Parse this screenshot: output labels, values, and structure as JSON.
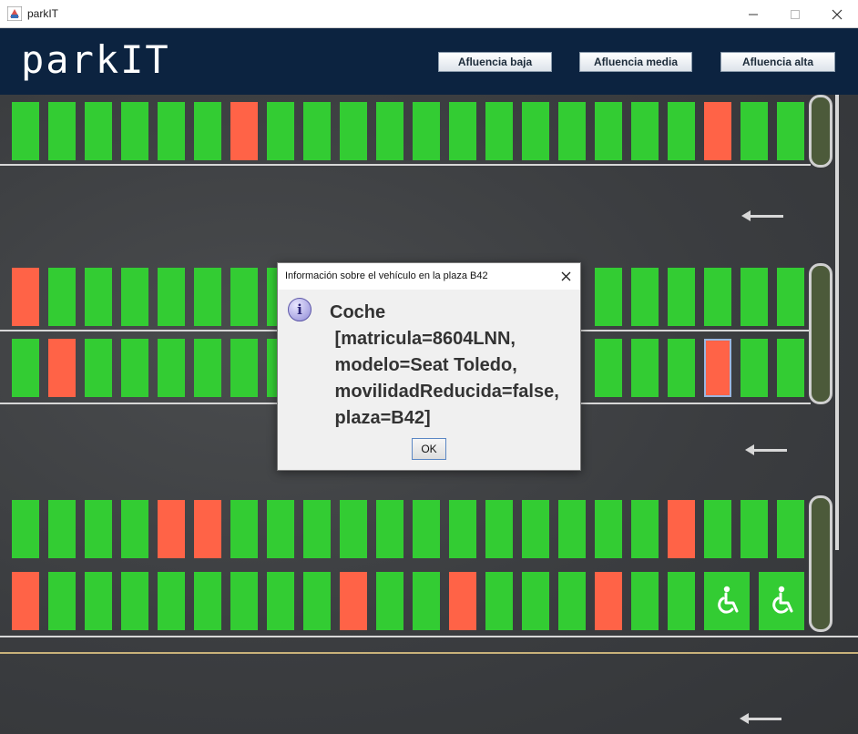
{
  "window": {
    "title": "parkIT",
    "minimize_icon": "minimize-icon",
    "maximize_icon": "maximize-icon",
    "close_icon": "close-icon"
  },
  "header": {
    "logo": "parkIT",
    "buttons": [
      {
        "label": "Afluencia baja"
      },
      {
        "label": "Afluencia media"
      },
      {
        "label": "Afluencia alta"
      }
    ]
  },
  "colors": {
    "free": "#33cc33",
    "occupied": "#ff6347",
    "header": "#0c2340"
  },
  "lot": {
    "row1": [
      "free",
      "free",
      "free",
      "free",
      "free",
      "free",
      "occupied",
      "free",
      "free",
      "free",
      "free",
      "free",
      "free",
      "free",
      "free",
      "free",
      "free",
      "free",
      "free",
      "occupied",
      "free",
      "free"
    ],
    "row2": [
      "occupied",
      "free",
      "free",
      "free",
      "free",
      "free",
      "free",
      "free",
      "hidden",
      "hidden",
      "hidden",
      "hidden",
      "hidden",
      "hidden",
      "hidden",
      "hidden",
      "free",
      "free",
      "free",
      "free",
      "free",
      "free"
    ],
    "row3": [
      "free",
      "occupied",
      "free",
      "free",
      "free",
      "free",
      "free",
      "free",
      "hidden",
      "hidden",
      "hidden",
      "hidden",
      "hidden",
      "hidden",
      "hidden",
      "hidden",
      "free",
      "free",
      "free",
      "selected",
      "free",
      "free"
    ],
    "row4": [
      "free",
      "free",
      "free",
      "free",
      "occupied",
      "occupied",
      "free",
      "free",
      "free",
      "free",
      "free",
      "free",
      "free",
      "free",
      "free",
      "free",
      "free",
      "free",
      "occupied",
      "free",
      "free",
      "free"
    ],
    "row5": [
      "occupied",
      "free",
      "free",
      "free",
      "free",
      "free",
      "free",
      "free",
      "free",
      "occupied",
      "free",
      "free",
      "occupied",
      "free",
      "free",
      "free",
      "occupied",
      "free",
      "free"
    ],
    "accessible_icon": "wheelchair-icon"
  },
  "dialog": {
    "title": "Información sobre el vehículo en la plaza B42",
    "message": "Coche\n [matricula=8604LNN,\n modelo=Seat Toledo,\n movilidadReducida=false,\n plaza=B42]",
    "ok_label": "OK",
    "icon": "info-icon",
    "close_icon": "close-icon"
  }
}
